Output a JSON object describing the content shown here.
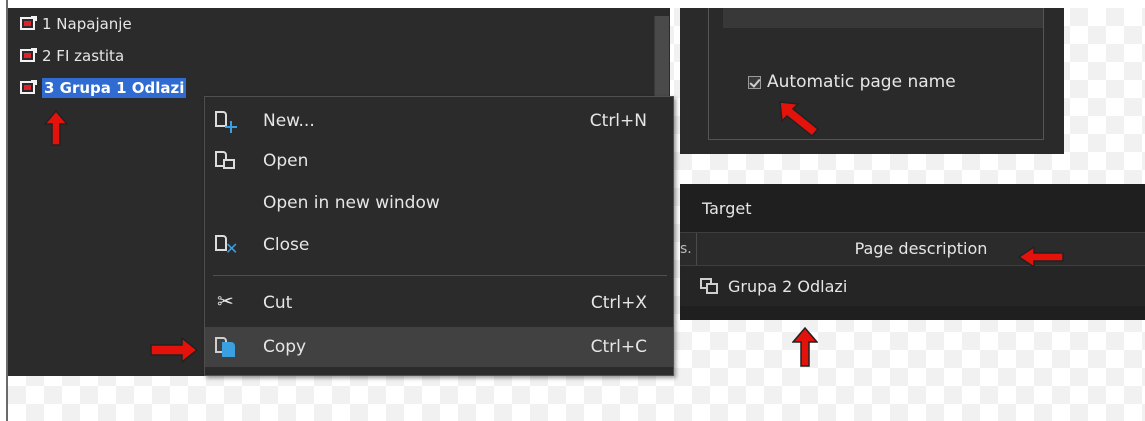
{
  "tree": {
    "items": [
      {
        "label": "1 Napajanje"
      },
      {
        "label": "2 FI zastita"
      },
      {
        "label": "3 Grupa 1 Odlazi"
      }
    ]
  },
  "settings": {
    "automatic_page_name": "Automatic page name",
    "checked": true
  },
  "table": {
    "target_label": "Target",
    "stub_header": "s.",
    "column_header": "Page description",
    "rows": [
      {
        "description": "Grupa 2 Odlazi"
      }
    ]
  },
  "context_menu": {
    "items": [
      {
        "label": "New...",
        "shortcut": "Ctrl+N"
      },
      {
        "label": "Open",
        "shortcut": ""
      },
      {
        "label": "Open in new window",
        "shortcut": ""
      },
      {
        "label": "Close",
        "shortcut": ""
      },
      {
        "label": "Cut",
        "shortcut": "Ctrl+X"
      },
      {
        "label": "Copy",
        "shortcut": "Ctrl+C"
      }
    ]
  },
  "colors": {
    "annotation_arrow": "#e3120b",
    "selection": "#2f6bd1",
    "icon_accent": "#3aa0e0"
  },
  "icons": [
    "page-icon",
    "new-icon",
    "open-icon",
    "close-icon",
    "cut-icon",
    "copy-icon",
    "page-link-icon",
    "checkbox",
    "red-arrow"
  ]
}
